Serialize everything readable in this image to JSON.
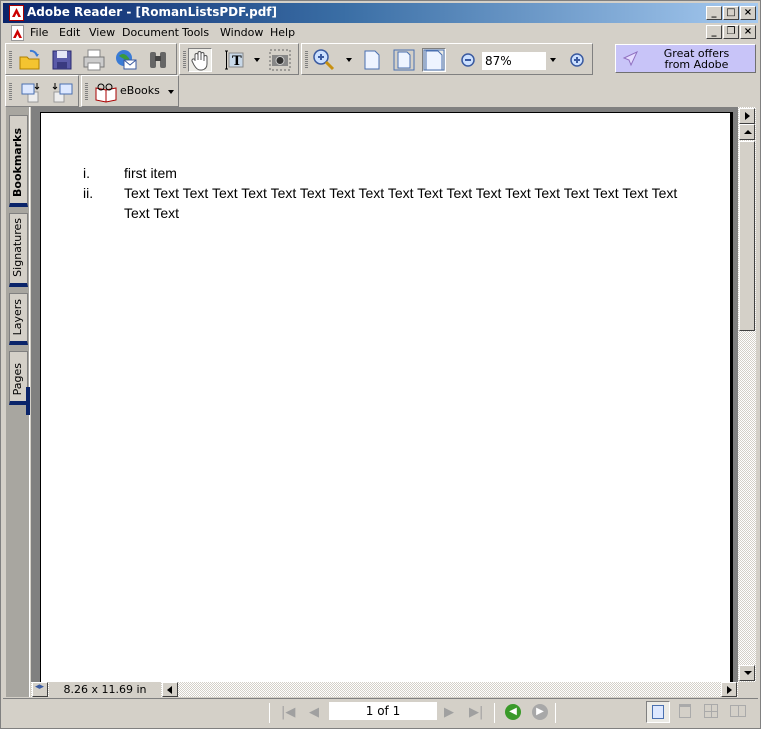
{
  "window": {
    "title": "Adobe Reader - [RomanListsPDF.pdf]",
    "caption_buttons": [
      "_",
      "□",
      "×"
    ],
    "doc_caption_buttons": [
      "_",
      "❐",
      "×"
    ]
  },
  "menu": {
    "items": [
      "File",
      "Edit",
      "View",
      "Document",
      "Tools",
      "Window",
      "Help"
    ]
  },
  "toolbar": {
    "file_tools": [
      "open-icon",
      "save-icon",
      "print-icon",
      "email-icon",
      "search-icon"
    ],
    "basic_tools": [
      "hand-icon",
      "select-text-icon",
      "snapshot-icon"
    ],
    "zoom_value": "87%",
    "promo_line1": "Great offers",
    "promo_line2": "from Adobe",
    "ebooks_label": "eBooks"
  },
  "side_tabs": [
    {
      "label": "Bookmarks",
      "active": true
    },
    {
      "label": "Signatures",
      "active": false
    },
    {
      "label": "Layers",
      "active": false
    },
    {
      "label": "Pages",
      "active": false
    }
  ],
  "document": {
    "list": [
      {
        "marker": "i.",
        "text": "first item"
      },
      {
        "marker": "ii.",
        "text": "Text Text Text Text Text Text Text Text Text Text Text Text Text Text Text Text Text Text Text Text Text"
      }
    ]
  },
  "status": {
    "page_size": "8.26 x 11.69 in",
    "page_indicator": "1 of 1"
  },
  "colors": {
    "titlebar_start": "#0a246a",
    "titlebar_end": "#a6caf0",
    "chrome": "#d4d0c8",
    "promo": "#c8c4f8"
  }
}
